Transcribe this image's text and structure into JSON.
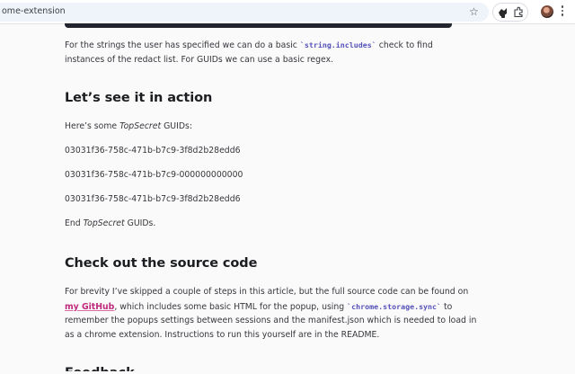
{
  "browser": {
    "url": "ome-extension",
    "bookmark_icon": "star-icon",
    "extensions": [
      "redact-extension-icon",
      "puzzle-icon"
    ],
    "profile": "avatar",
    "menu_icon": "kebab-menu-icon"
  },
  "article": {
    "intro": {
      "line1_before": "For the strings the user has specified we can do a basic ",
      "line1_code": "`string.includes`",
      "line1_after": " check to find",
      "line2": "instances of the redact list. For GUIDs we can use a basic regex."
    },
    "section1": {
      "heading": "Let’s see it in action",
      "lead_before": "Here’s some ",
      "lead_em": "TopSecret",
      "lead_after": " GUIDs:",
      "guids": [
        "03031f36-758c-471b-b7c9-3f8d2b28edd6",
        "03031f36-758c-471b-b7c9-000000000000",
        "03031f36-758c-471b-b7c9-3f8d2b28edd6"
      ],
      "end_before": "End ",
      "end_em": "TopSecret",
      "end_after": " GUIDs."
    },
    "section2": {
      "heading": "Check out the source code",
      "line1": "For brevity I’ve skipped a couple of steps in this article, but the full source code can be found on",
      "line2_link": "my GitHub",
      "line2_mid": ", which includes some basic HTML for the popup, using ",
      "line2_code": "`chrome.storage.sync`",
      "line2_after": " to",
      "line3": "remember the popups settings between sessions and the manifest.json which is needed to load in",
      "line4": "as a chrome extension. Instructions to run this yourself are in the README."
    },
    "next_heading_partial": "Feedback"
  }
}
